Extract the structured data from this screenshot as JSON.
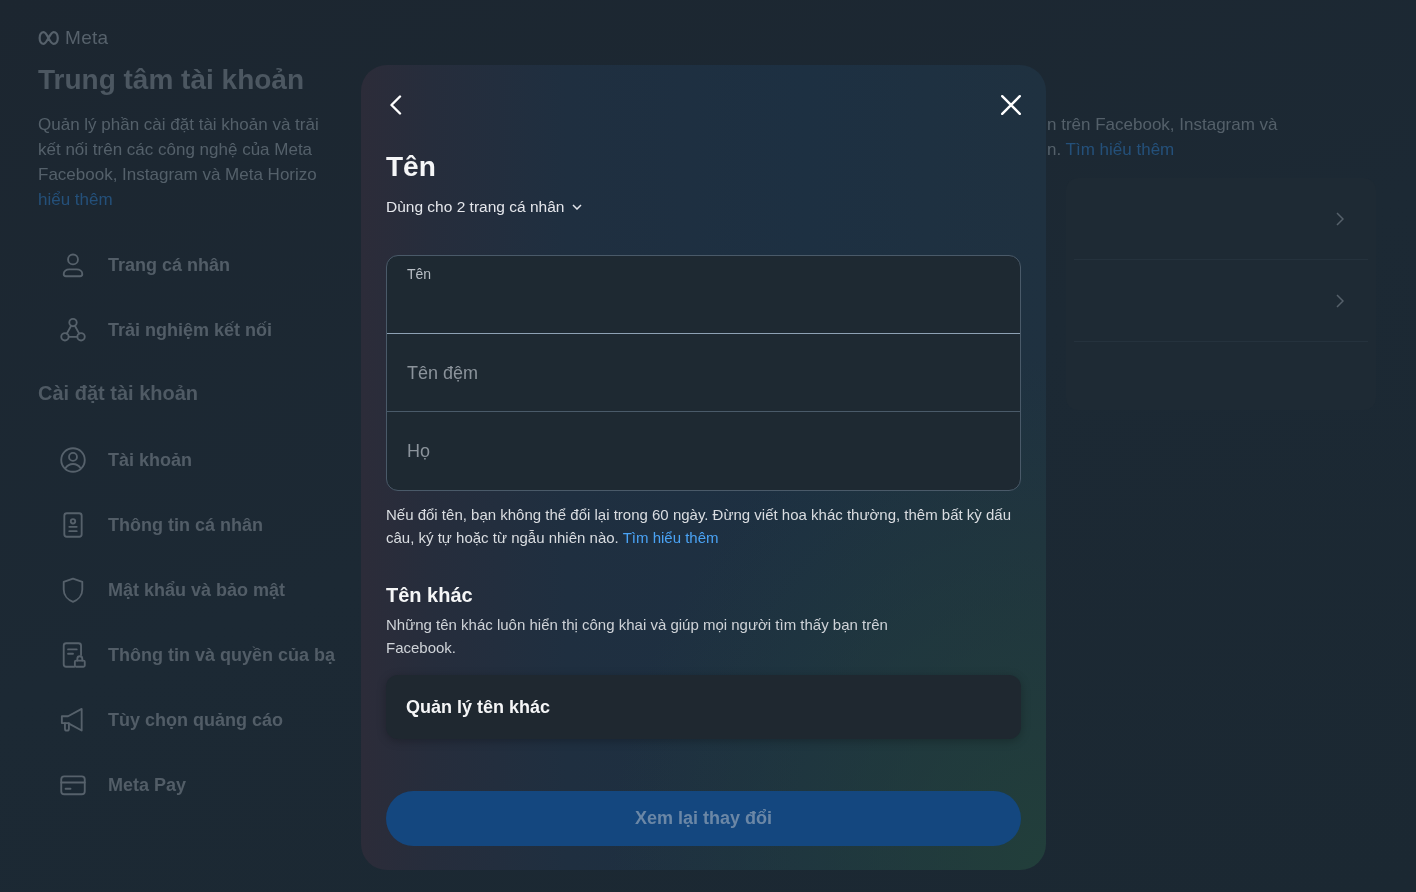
{
  "page": {
    "logo": "Meta",
    "title": "Trung tâm tài khoản",
    "description_lines": [
      "Quản lý phần cài đặt tài khoản và trải",
      "kết nối trên các công nghệ của Meta",
      "Facebook, Instagram và Meta Horizo"
    ],
    "description_link": "hiểu thêm",
    "nav": [
      {
        "label": "Trang cá nhân",
        "selected": false
      },
      {
        "label": "Trải nghiệm kết nối",
        "selected": false
      }
    ],
    "section_title": "Cài đặt tài khoản",
    "settings": [
      {
        "label": "Tài khoản",
        "selected": false
      },
      {
        "label": "Thông tin cá nhân",
        "selected": false
      },
      {
        "label": "Mật khẩu và bảo mật",
        "selected": false
      },
      {
        "label": "Thông tin và quyền của bạ",
        "selected": false
      },
      {
        "label": "Tùy chọn quảng cáo",
        "selected": false
      },
      {
        "label": "Meta Pay",
        "selected": false
      }
    ]
  },
  "main": {
    "description_lines": [
      "n trên Facebook, Instagram và",
      "n."
    ],
    "description_link": "Tìm hiểu thêm"
  },
  "dialog": {
    "title": "Tên",
    "profiles_menu": "Dùng cho 2 trang cá nhân",
    "fields": [
      {
        "label": "Tên",
        "focused": true
      },
      {
        "label": "Tên đệm",
        "focused": false
      },
      {
        "label": "Họ",
        "focused": false
      }
    ],
    "notice": "Nếu đổi tên, bạn không thể đổi lại trong 60 ngày. Đừng viết hoa khác thường, thêm bất kỳ dấu câu, ký tự hoặc từ ngẫu nhiên nào.",
    "notice_link": "Tìm hiểu thêm",
    "other_names": {
      "title": "Tên khác",
      "description": "Những tên khác luôn hiển thị công khai và giúp mọi người tìm thấy bạn trên Facebook.",
      "button": "Quản lý tên khác"
    },
    "submit": {
      "label": "Xem lại thay đổi",
      "disabled": true
    }
  }
}
